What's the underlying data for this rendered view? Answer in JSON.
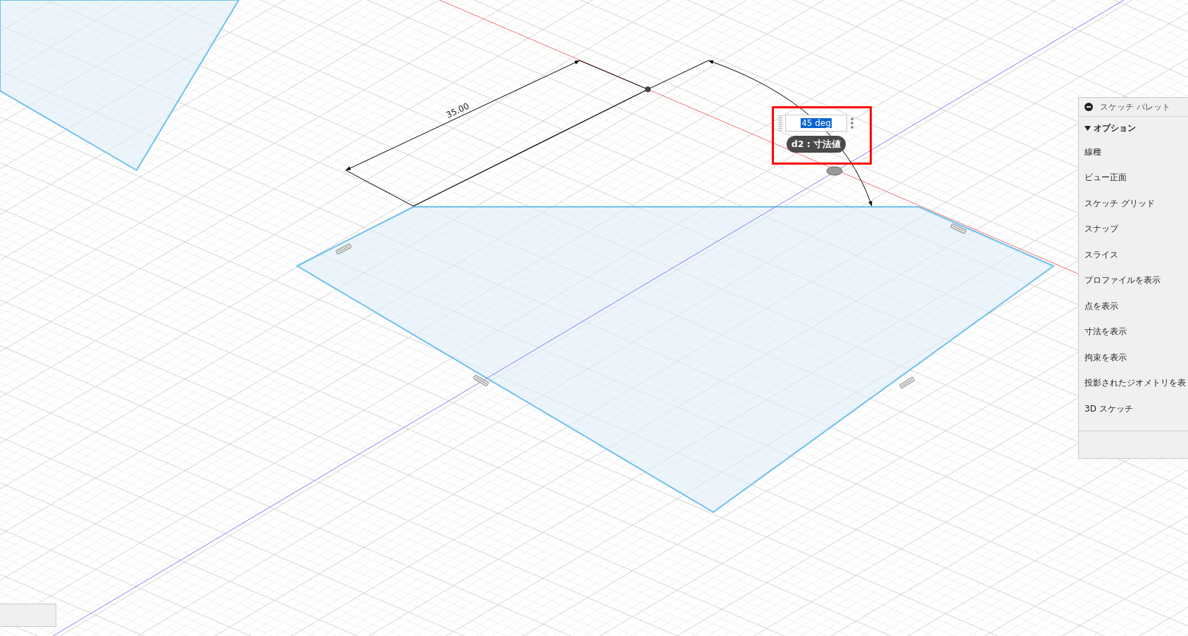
{
  "canvas": {
    "dimension_label": "35.00",
    "angle_input": {
      "value": "45 deg",
      "value_selected": true,
      "tag": "d2 : 寸法値"
    }
  },
  "sketch_palette": {
    "title": "スケッチ パレット",
    "section": {
      "label": "オプション",
      "expanded": true
    },
    "items": [
      "線種",
      "ビュー正面",
      "スケッチ グリッド",
      "スナップ",
      "スライス",
      "プロファイルを表示",
      "点を表示",
      "寸法を表示",
      "拘束を表示",
      "投影されたジオメトリを表",
      "3D スケッチ"
    ]
  }
}
